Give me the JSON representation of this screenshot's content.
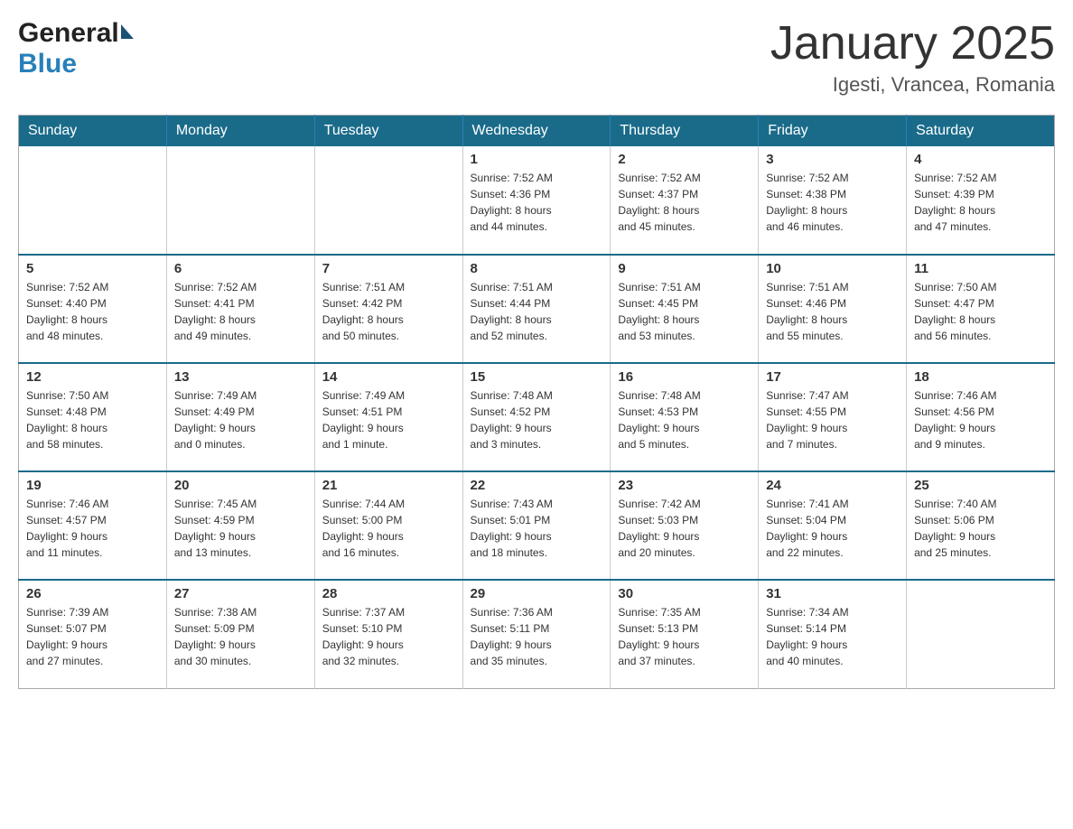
{
  "header": {
    "logo_general": "General",
    "logo_blue": "Blue",
    "month_title": "January 2025",
    "location": "Igesti, Vrancea, Romania"
  },
  "weekdays": [
    "Sunday",
    "Monday",
    "Tuesday",
    "Wednesday",
    "Thursday",
    "Friday",
    "Saturday"
  ],
  "weeks": [
    [
      {
        "day": "",
        "info": ""
      },
      {
        "day": "",
        "info": ""
      },
      {
        "day": "",
        "info": ""
      },
      {
        "day": "1",
        "info": "Sunrise: 7:52 AM\nSunset: 4:36 PM\nDaylight: 8 hours\nand 44 minutes."
      },
      {
        "day": "2",
        "info": "Sunrise: 7:52 AM\nSunset: 4:37 PM\nDaylight: 8 hours\nand 45 minutes."
      },
      {
        "day": "3",
        "info": "Sunrise: 7:52 AM\nSunset: 4:38 PM\nDaylight: 8 hours\nand 46 minutes."
      },
      {
        "day": "4",
        "info": "Sunrise: 7:52 AM\nSunset: 4:39 PM\nDaylight: 8 hours\nand 47 minutes."
      }
    ],
    [
      {
        "day": "5",
        "info": "Sunrise: 7:52 AM\nSunset: 4:40 PM\nDaylight: 8 hours\nand 48 minutes."
      },
      {
        "day": "6",
        "info": "Sunrise: 7:52 AM\nSunset: 4:41 PM\nDaylight: 8 hours\nand 49 minutes."
      },
      {
        "day": "7",
        "info": "Sunrise: 7:51 AM\nSunset: 4:42 PM\nDaylight: 8 hours\nand 50 minutes."
      },
      {
        "day": "8",
        "info": "Sunrise: 7:51 AM\nSunset: 4:44 PM\nDaylight: 8 hours\nand 52 minutes."
      },
      {
        "day": "9",
        "info": "Sunrise: 7:51 AM\nSunset: 4:45 PM\nDaylight: 8 hours\nand 53 minutes."
      },
      {
        "day": "10",
        "info": "Sunrise: 7:51 AM\nSunset: 4:46 PM\nDaylight: 8 hours\nand 55 minutes."
      },
      {
        "day": "11",
        "info": "Sunrise: 7:50 AM\nSunset: 4:47 PM\nDaylight: 8 hours\nand 56 minutes."
      }
    ],
    [
      {
        "day": "12",
        "info": "Sunrise: 7:50 AM\nSunset: 4:48 PM\nDaylight: 8 hours\nand 58 minutes."
      },
      {
        "day": "13",
        "info": "Sunrise: 7:49 AM\nSunset: 4:49 PM\nDaylight: 9 hours\nand 0 minutes."
      },
      {
        "day": "14",
        "info": "Sunrise: 7:49 AM\nSunset: 4:51 PM\nDaylight: 9 hours\nand 1 minute."
      },
      {
        "day": "15",
        "info": "Sunrise: 7:48 AM\nSunset: 4:52 PM\nDaylight: 9 hours\nand 3 minutes."
      },
      {
        "day": "16",
        "info": "Sunrise: 7:48 AM\nSunset: 4:53 PM\nDaylight: 9 hours\nand 5 minutes."
      },
      {
        "day": "17",
        "info": "Sunrise: 7:47 AM\nSunset: 4:55 PM\nDaylight: 9 hours\nand 7 minutes."
      },
      {
        "day": "18",
        "info": "Sunrise: 7:46 AM\nSunset: 4:56 PM\nDaylight: 9 hours\nand 9 minutes."
      }
    ],
    [
      {
        "day": "19",
        "info": "Sunrise: 7:46 AM\nSunset: 4:57 PM\nDaylight: 9 hours\nand 11 minutes."
      },
      {
        "day": "20",
        "info": "Sunrise: 7:45 AM\nSunset: 4:59 PM\nDaylight: 9 hours\nand 13 minutes."
      },
      {
        "day": "21",
        "info": "Sunrise: 7:44 AM\nSunset: 5:00 PM\nDaylight: 9 hours\nand 16 minutes."
      },
      {
        "day": "22",
        "info": "Sunrise: 7:43 AM\nSunset: 5:01 PM\nDaylight: 9 hours\nand 18 minutes."
      },
      {
        "day": "23",
        "info": "Sunrise: 7:42 AM\nSunset: 5:03 PM\nDaylight: 9 hours\nand 20 minutes."
      },
      {
        "day": "24",
        "info": "Sunrise: 7:41 AM\nSunset: 5:04 PM\nDaylight: 9 hours\nand 22 minutes."
      },
      {
        "day": "25",
        "info": "Sunrise: 7:40 AM\nSunset: 5:06 PM\nDaylight: 9 hours\nand 25 minutes."
      }
    ],
    [
      {
        "day": "26",
        "info": "Sunrise: 7:39 AM\nSunset: 5:07 PM\nDaylight: 9 hours\nand 27 minutes."
      },
      {
        "day": "27",
        "info": "Sunrise: 7:38 AM\nSunset: 5:09 PM\nDaylight: 9 hours\nand 30 minutes."
      },
      {
        "day": "28",
        "info": "Sunrise: 7:37 AM\nSunset: 5:10 PM\nDaylight: 9 hours\nand 32 minutes."
      },
      {
        "day": "29",
        "info": "Sunrise: 7:36 AM\nSunset: 5:11 PM\nDaylight: 9 hours\nand 35 minutes."
      },
      {
        "day": "30",
        "info": "Sunrise: 7:35 AM\nSunset: 5:13 PM\nDaylight: 9 hours\nand 37 minutes."
      },
      {
        "day": "31",
        "info": "Sunrise: 7:34 AM\nSunset: 5:14 PM\nDaylight: 9 hours\nand 40 minutes."
      },
      {
        "day": "",
        "info": ""
      }
    ]
  ]
}
